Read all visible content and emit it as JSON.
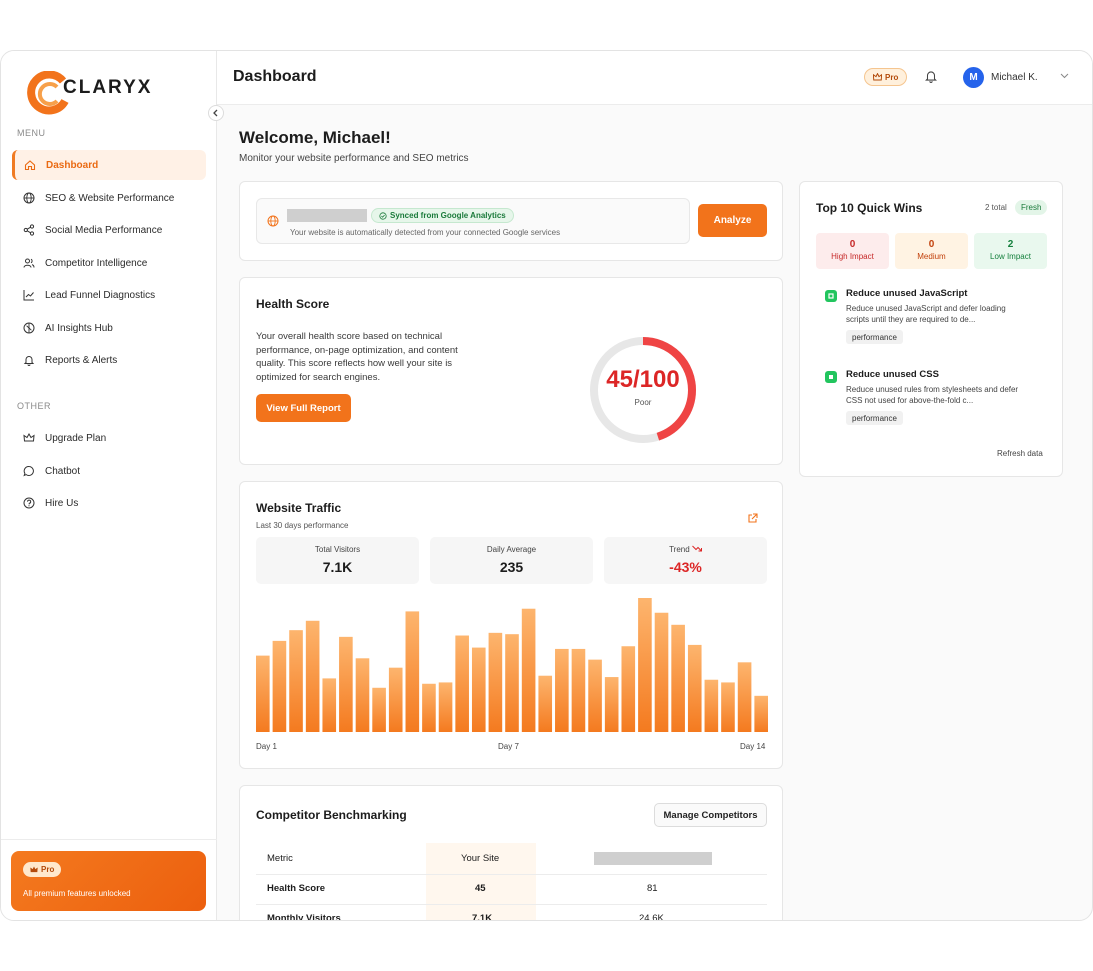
{
  "brand": {
    "name": "CLARYX",
    "accent": "#f2731b"
  },
  "sidebar": {
    "menu_label": "MENU",
    "items": [
      {
        "label": "Dashboard",
        "icon": "home-icon",
        "active": true
      },
      {
        "label": "SEO & Website Performance",
        "icon": "globe-icon"
      },
      {
        "label": "Social Media Performance",
        "icon": "share-icon"
      },
      {
        "label": "Competitor Intelligence",
        "icon": "users-icon"
      },
      {
        "label": "Lead Funnel Diagnostics",
        "icon": "trend-chart-icon"
      },
      {
        "label": "AI Insights Hub",
        "icon": "brain-icon"
      },
      {
        "label": "Reports & Alerts",
        "icon": "bell-icon"
      }
    ],
    "other_label": "OTHER",
    "other_items": [
      {
        "label": "Upgrade Plan",
        "icon": "crown-icon"
      },
      {
        "label": "Chatbot",
        "icon": "chat-icon"
      },
      {
        "label": "Hire Us",
        "icon": "help-circle-icon"
      }
    ],
    "pro_card": {
      "badge": "Pro",
      "text": "All premium features unlocked"
    }
  },
  "header": {
    "title": "Dashboard",
    "pro_badge": "Pro",
    "user": {
      "initial": "M",
      "name": "Michael K."
    }
  },
  "welcome": {
    "title": "Welcome, Michael!",
    "subtitle": "Monitor your website performance and SEO metrics"
  },
  "url_bar": {
    "synced_label": "Synced from Google Analytics",
    "note": "Your website is automatically detected from your connected Google services",
    "analyze_label": "Analyze"
  },
  "health": {
    "title": "Health Score",
    "description": "Your overall health score based on technical performance, on-page optimization, and content quality. This score reflects how well your site is optimized for search engines.",
    "button_label": "View Full Report",
    "score_text": "45/100",
    "score": 45,
    "max": 100,
    "rating": "Poor",
    "color": "#ef4444"
  },
  "traffic": {
    "title": "Website Traffic",
    "subtitle": "Last 30 days performance",
    "stats": [
      {
        "label": "Total Visitors",
        "value": "7.1K"
      },
      {
        "label": "Daily Average",
        "value": "235"
      },
      {
        "label": "Trend",
        "value": "-43%"
      }
    ],
    "x_labels": [
      "Day 1",
      "Day 7",
      "Day 14"
    ],
    "chart_data": {
      "type": "bar",
      "values": [
        57,
        68,
        76,
        83,
        40,
        71,
        55,
        33,
        48,
        90,
        36,
        37,
        72,
        63,
        74,
        73,
        92,
        42,
        62,
        62,
        54,
        41,
        64,
        100,
        89,
        80,
        65,
        39,
        37,
        52,
        27
      ],
      "ylim": [
        0,
        100
      ]
    }
  },
  "benchmark": {
    "title": "Competitor Benchmarking",
    "button_label": "Manage Competitors",
    "headers": [
      "Metric",
      "Your Site"
    ],
    "rows": [
      {
        "metric": "Health Score",
        "your": "45",
        "competitor": "81"
      },
      {
        "metric": "Monthly Visitors",
        "your": "7.1K",
        "competitor": "24.6K"
      }
    ]
  },
  "quick_wins": {
    "title": "Top 10 Quick Wins",
    "total": "2 total",
    "fresh": "Fresh",
    "impacts": [
      {
        "count": "0",
        "label": "High Impact",
        "bg": "#fdecec",
        "color": "#c62828"
      },
      {
        "count": "0",
        "label": "Medium",
        "bg": "#fff3e3",
        "color": "#c2410c"
      },
      {
        "count": "2",
        "label": "Low Impact",
        "bg": "#e9f8ee",
        "color": "#15803d"
      }
    ],
    "items": [
      {
        "title": "Reduce unused JavaScript",
        "description": "Reduce unused JavaScript and defer loading scripts until they are required to de...",
        "tag": "performance"
      },
      {
        "title": "Reduce unused CSS",
        "description": "Reduce unused rules from stylesheets and defer CSS not used for above-the-fold c...",
        "tag": "performance"
      }
    ],
    "refresh_label": "Refresh data"
  }
}
